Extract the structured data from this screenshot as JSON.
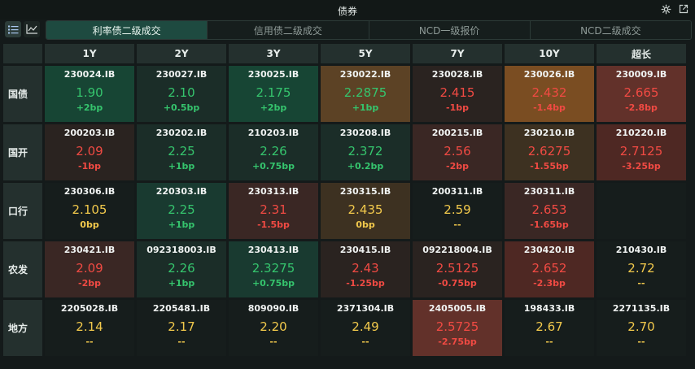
{
  "window": {
    "title": "债券"
  },
  "icons": {
    "settings": "gear-icon",
    "popout": "external-link-icon",
    "list_view": "list-icon",
    "chart_view": "line-chart-icon"
  },
  "tabs": [
    "利率债二级成交",
    "信用债二级成交",
    "NCD一级报价",
    "NCD二级成交"
  ],
  "active_tab": 0,
  "colors": {
    "up": "#35c46d",
    "down": "#f04a43",
    "flat": "#f2c94c",
    "active_tab": "#1e4a40"
  },
  "columns": [
    "1Y",
    "2Y",
    "3Y",
    "5Y",
    "7Y",
    "10Y",
    "超长"
  ],
  "rows": [
    {
      "label": "国债",
      "cells": [
        {
          "code": "230024.IB",
          "yield": "1.90",
          "change": "+2bp",
          "dir": "g",
          "bg": "bg-g3"
        },
        {
          "code": "230027.IB",
          "yield": "2.10",
          "change": "+0.5bp",
          "dir": "g",
          "bg": "bg-g1"
        },
        {
          "code": "230025.IB",
          "yield": "2.175",
          "change": "+2bp",
          "dir": "g",
          "bg": "bg-g3"
        },
        {
          "code": "230022.IB",
          "yield": "2.2875",
          "change": "+1bp",
          "dir": "g",
          "bg": "bg-o2"
        },
        {
          "code": "230028.IB",
          "yield": "2.415",
          "change": "-1bp",
          "dir": "r",
          "bg": "bg-r1"
        },
        {
          "code": "230026.IB",
          "yield": "2.432",
          "change": "-1.4bp",
          "dir": "r",
          "bg": "bg-o3"
        },
        {
          "code": "230009.IB",
          "yield": "2.665",
          "change": "-2.8bp",
          "dir": "r",
          "bg": "bg-r4"
        }
      ]
    },
    {
      "label": "国开",
      "cells": [
        {
          "code": "200203.IB",
          "yield": "2.09",
          "change": "-1bp",
          "dir": "r",
          "bg": "bg-r1"
        },
        {
          "code": "230202.IB",
          "yield": "2.25",
          "change": "+1bp",
          "dir": "g",
          "bg": "bg-g1"
        },
        {
          "code": "210203.IB",
          "yield": "2.26",
          "change": "+0.75bp",
          "dir": "g",
          "bg": "bg-g1"
        },
        {
          "code": "230208.IB",
          "yield": "2.372",
          "change": "+0.2bp",
          "dir": "g",
          "bg": "bg-g1"
        },
        {
          "code": "200215.IB",
          "yield": "2.56",
          "change": "-2bp",
          "dir": "r",
          "bg": "bg-r2"
        },
        {
          "code": "230210.IB",
          "yield": "2.6275",
          "change": "-1.55bp",
          "dir": "r",
          "bg": "bg-o1"
        },
        {
          "code": "210220.IB",
          "yield": "2.7125",
          "change": "-3.25bp",
          "dir": "r",
          "bg": "bg-r3"
        }
      ]
    },
    {
      "label": "口行",
      "cells": [
        {
          "code": "230306.IB",
          "yield": "2.105",
          "change": "0bp",
          "dir": "y",
          "bg": "bg-n"
        },
        {
          "code": "220303.IB",
          "yield": "2.25",
          "change": "+1bp",
          "dir": "g",
          "bg": "bg-g2"
        },
        {
          "code": "230313.IB",
          "yield": "2.31",
          "change": "-1.5bp",
          "dir": "r",
          "bg": "bg-r2"
        },
        {
          "code": "230315.IB",
          "yield": "2.435",
          "change": "0bp",
          "dir": "y",
          "bg": "bg-o1"
        },
        {
          "code": "200311.IB",
          "yield": "2.59",
          "change": "--",
          "dir": "y",
          "bg": "bg-n"
        },
        {
          "code": "230311.IB",
          "yield": "2.653",
          "change": "-1.65bp",
          "dir": "r",
          "bg": "bg-r2"
        },
        {
          "code": "",
          "yield": "",
          "change": "",
          "dir": "y",
          "bg": "bg-n"
        }
      ]
    },
    {
      "label": "农发",
      "cells": [
        {
          "code": "230421.IB",
          "yield": "2.09",
          "change": "-2bp",
          "dir": "r",
          "bg": "bg-r2"
        },
        {
          "code": "092318003.IB",
          "yield": "2.26",
          "change": "+1bp",
          "dir": "g",
          "bg": "bg-g1"
        },
        {
          "code": "230413.IB",
          "yield": "2.3275",
          "change": "+0.75bp",
          "dir": "g",
          "bg": "bg-g2"
        },
        {
          "code": "230415.IB",
          "yield": "2.43",
          "change": "-1.25bp",
          "dir": "r",
          "bg": "bg-r1"
        },
        {
          "code": "092218004.IB",
          "yield": "2.5125",
          "change": "-0.75bp",
          "dir": "r",
          "bg": "bg-r1"
        },
        {
          "code": "230420.IB",
          "yield": "2.652",
          "change": "-2.3bp",
          "dir": "r",
          "bg": "bg-r3"
        },
        {
          "code": "210430.IB",
          "yield": "2.72",
          "change": "--",
          "dir": "y",
          "bg": "bg-n"
        }
      ]
    },
    {
      "label": "地方",
      "cells": [
        {
          "code": "2205028.IB",
          "yield": "2.14",
          "change": "--",
          "dir": "y",
          "bg": "bg-n"
        },
        {
          "code": "2205481.IB",
          "yield": "2.17",
          "change": "--",
          "dir": "y",
          "bg": "bg-n"
        },
        {
          "code": "809090.IB",
          "yield": "2.20",
          "change": "--",
          "dir": "y",
          "bg": "bg-n"
        },
        {
          "code": "2371304.IB",
          "yield": "2.49",
          "change": "--",
          "dir": "y",
          "bg": "bg-n"
        },
        {
          "code": "2405005.IB",
          "yield": "2.5725",
          "change": "-2.75bp",
          "dir": "r",
          "bg": "bg-r4"
        },
        {
          "code": "198433.IB",
          "yield": "2.67",
          "change": "--",
          "dir": "y",
          "bg": "bg-n"
        },
        {
          "code": "2271135.IB",
          "yield": "2.70",
          "change": "--",
          "dir": "y",
          "bg": "bg-n"
        }
      ]
    }
  ]
}
